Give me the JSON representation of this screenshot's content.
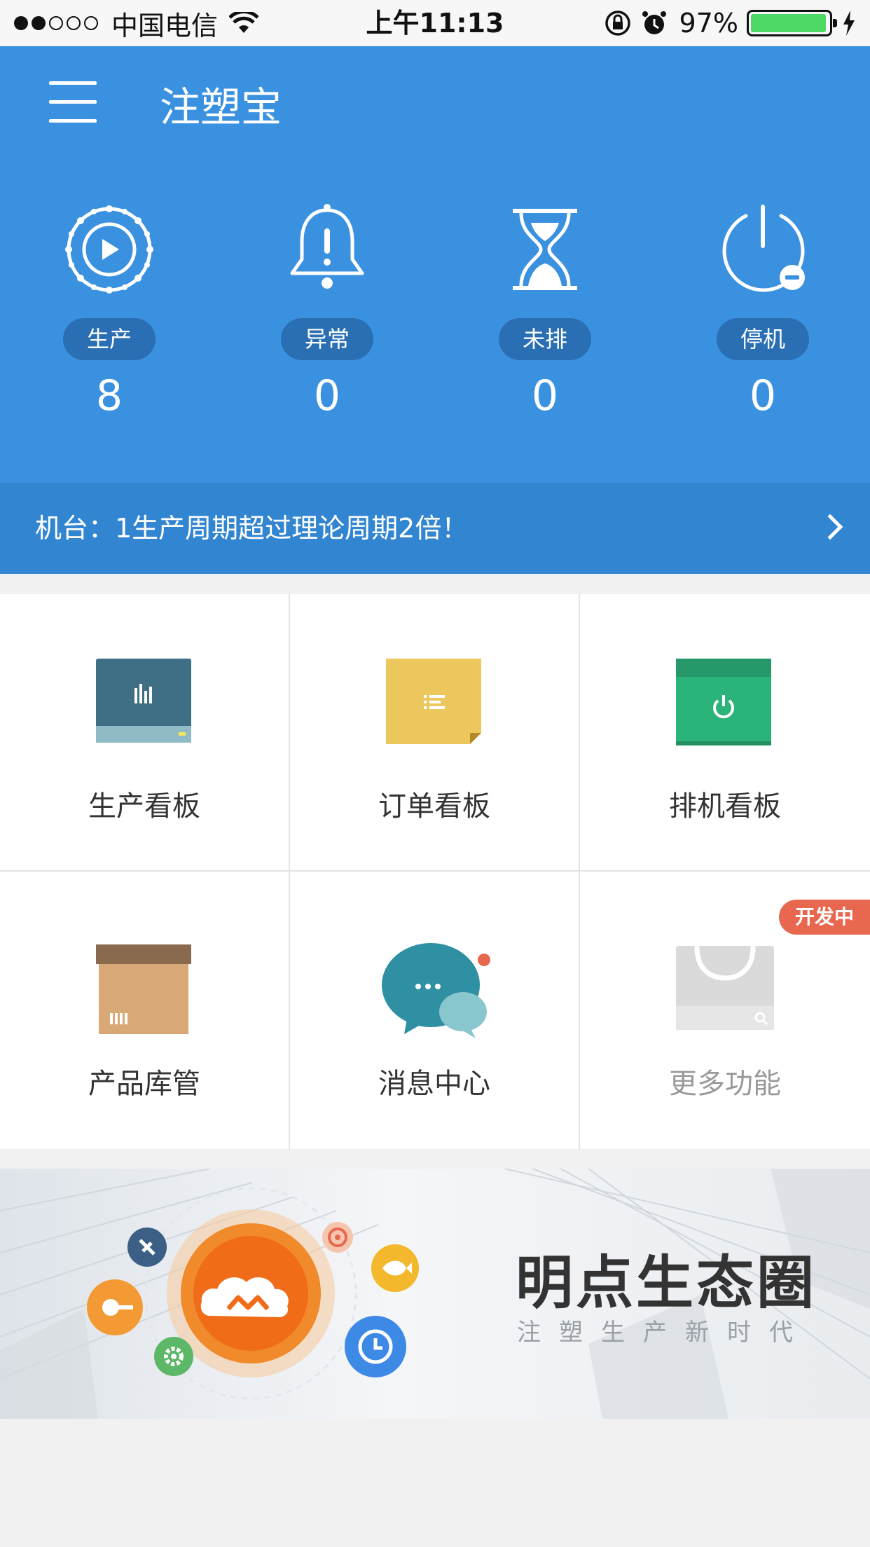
{
  "status_bar": {
    "carrier": "中国电信",
    "time": "上午11:13",
    "battery": "97%"
  },
  "header": {
    "title": "注塑宝"
  },
  "stats": [
    {
      "label": "生产",
      "value": "8"
    },
    {
      "label": "异常",
      "value": "0"
    },
    {
      "label": "未排",
      "value": "0"
    },
    {
      "label": "停机",
      "value": "0"
    }
  ],
  "alert": {
    "text": "机台：1生产周期超过理论周期2倍！"
  },
  "grid": [
    {
      "label": "生产看板"
    },
    {
      "label": "订单看板"
    },
    {
      "label": "排机看板"
    },
    {
      "label": "产品库管"
    },
    {
      "label": "消息中心"
    },
    {
      "label": "更多功能",
      "badge": "开发中"
    }
  ],
  "banner": {
    "title": "明点生态圈",
    "subtitle": "注塑生产新时代"
  },
  "colors": {
    "header_blue": "#3a91e0",
    "pill_blue": "#2a6fb4",
    "badge_red": "#e8674f",
    "battery_green": "#4cd964"
  }
}
